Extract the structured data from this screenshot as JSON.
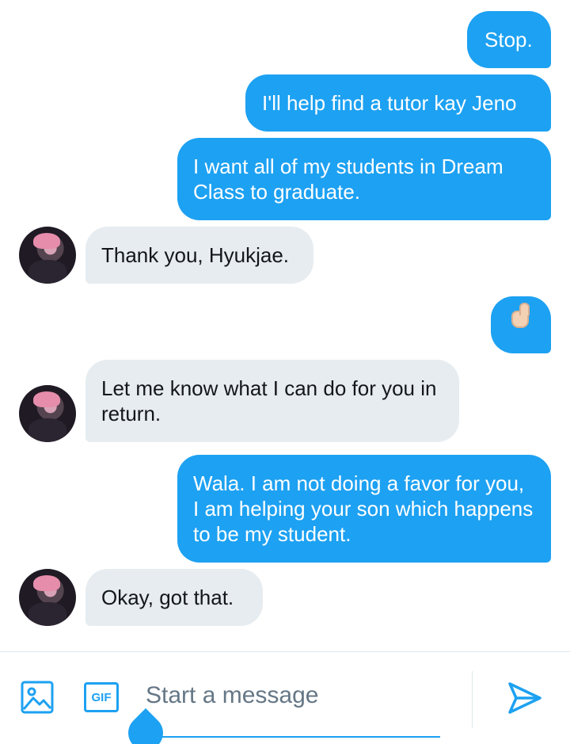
{
  "conversation": {
    "messages": [
      {
        "text": "Stop."
      },
      {
        "text": "I'll help find a tutor kay Jeno"
      },
      {
        "text": "I want all of my students in Dream Class to graduate."
      },
      {
        "text": "Thank you, Hyukjae."
      },
      {
        "icon": "thumbs-up-emoji"
      },
      {
        "text": "Let me know what I can do for you in return."
      },
      {
        "text": "Wala. I am not doing a favor for you, I am helping your son which happens to be my student."
      },
      {
        "text": "Okay, got that."
      }
    ]
  },
  "composer": {
    "placeholder": "Start a message",
    "gif_label": "GIF",
    "icons": [
      "image-icon",
      "gif-icon",
      "send-icon"
    ]
  },
  "colors": {
    "accent": "#1da1f2",
    "received_bubble": "#e6ecf0",
    "placeholder": "#657786"
  }
}
